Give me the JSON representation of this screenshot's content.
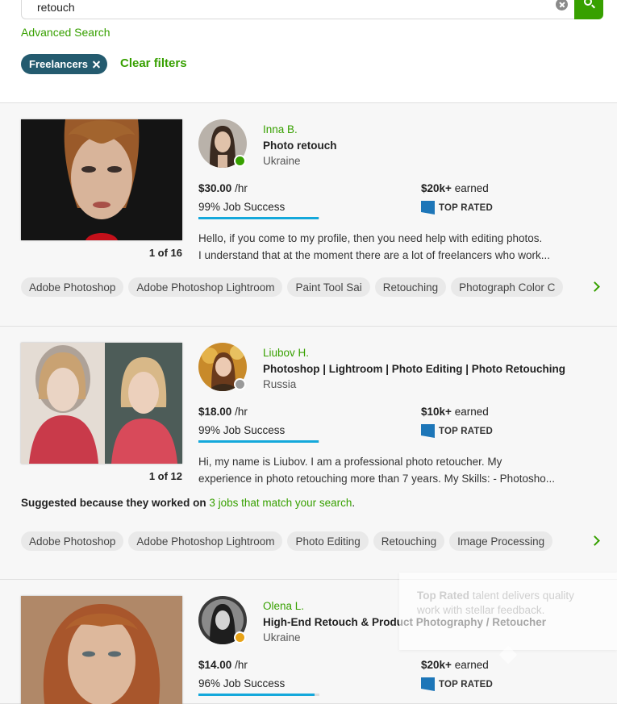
{
  "search": {
    "value": "retouch",
    "advanced_label": "Advanced Search",
    "filter_chip": "Freelancers",
    "clear_filters": "Clear filters"
  },
  "colors": {
    "accent_green": "#37a000",
    "chip_blue": "#245b6f",
    "progress_blue": "#14a8db",
    "badge_blue": "#1d76b8",
    "online": "#37a000",
    "offline": "#9a9a9a",
    "away": "#e8a317"
  },
  "freelancers": [
    {
      "name": "Inna B.",
      "title": "Photo retouch",
      "country": "Ukraine",
      "rate": "$30.00",
      "rate_unit": "/hr",
      "earned": "$20k+",
      "earned_label": "earned",
      "job_success": "99% Job Success",
      "job_success_pct": 99,
      "badge": "TOP RATED",
      "portfolio_count": "1 of 16",
      "status": "online",
      "description_1": "Hello, if you come to my profile, then you need help with editing photos.",
      "description_2": "I understand that at the moment there are a lot of freelancers who work...",
      "skills": [
        "Adobe Photoshop",
        "Adobe Photoshop Lightroom",
        "Paint Tool Sai",
        "Retouching",
        "Photograph Color C"
      ]
    },
    {
      "name": "Liubov H.",
      "title": "Photoshop | Lightroom | Photo Editing | Photo Retouching",
      "country": "Russia",
      "rate": "$18.00",
      "rate_unit": "/hr",
      "earned": "$10k+",
      "earned_label": "earned",
      "job_success": "99% Job Success",
      "job_success_pct": 99,
      "badge": "TOP RATED",
      "portfolio_count": "1 of 12",
      "status": "offline",
      "description_1": "Hi, my name is Liubov. I am a professional photo retoucher. My",
      "description_2": "experience in photo retouching more than 7 years. My Skills: - Photosho...",
      "suggested_prefix": "Suggested because they worked on",
      "suggested_link": "3 jobs that match your search",
      "suggested_suffix": ".",
      "skills": [
        "Adobe Photoshop",
        "Adobe Photoshop Lightroom",
        "Photo Editing",
        "Retouching",
        "Image Processing"
      ]
    },
    {
      "name": "Olena L.",
      "title": "High-End Retouch & Product Photography / Retoucher",
      "country": "Ukraine",
      "rate": "$14.00",
      "rate_unit": "/hr",
      "earned": "$20k+",
      "earned_label": "earned",
      "job_success": "96% Job Success",
      "job_success_pct": 96,
      "badge": "TOP RATED",
      "status": "away"
    }
  ],
  "tooltip": {
    "bold": "Top Rated",
    "text": "talent delivers quality work with stellar feedback."
  }
}
